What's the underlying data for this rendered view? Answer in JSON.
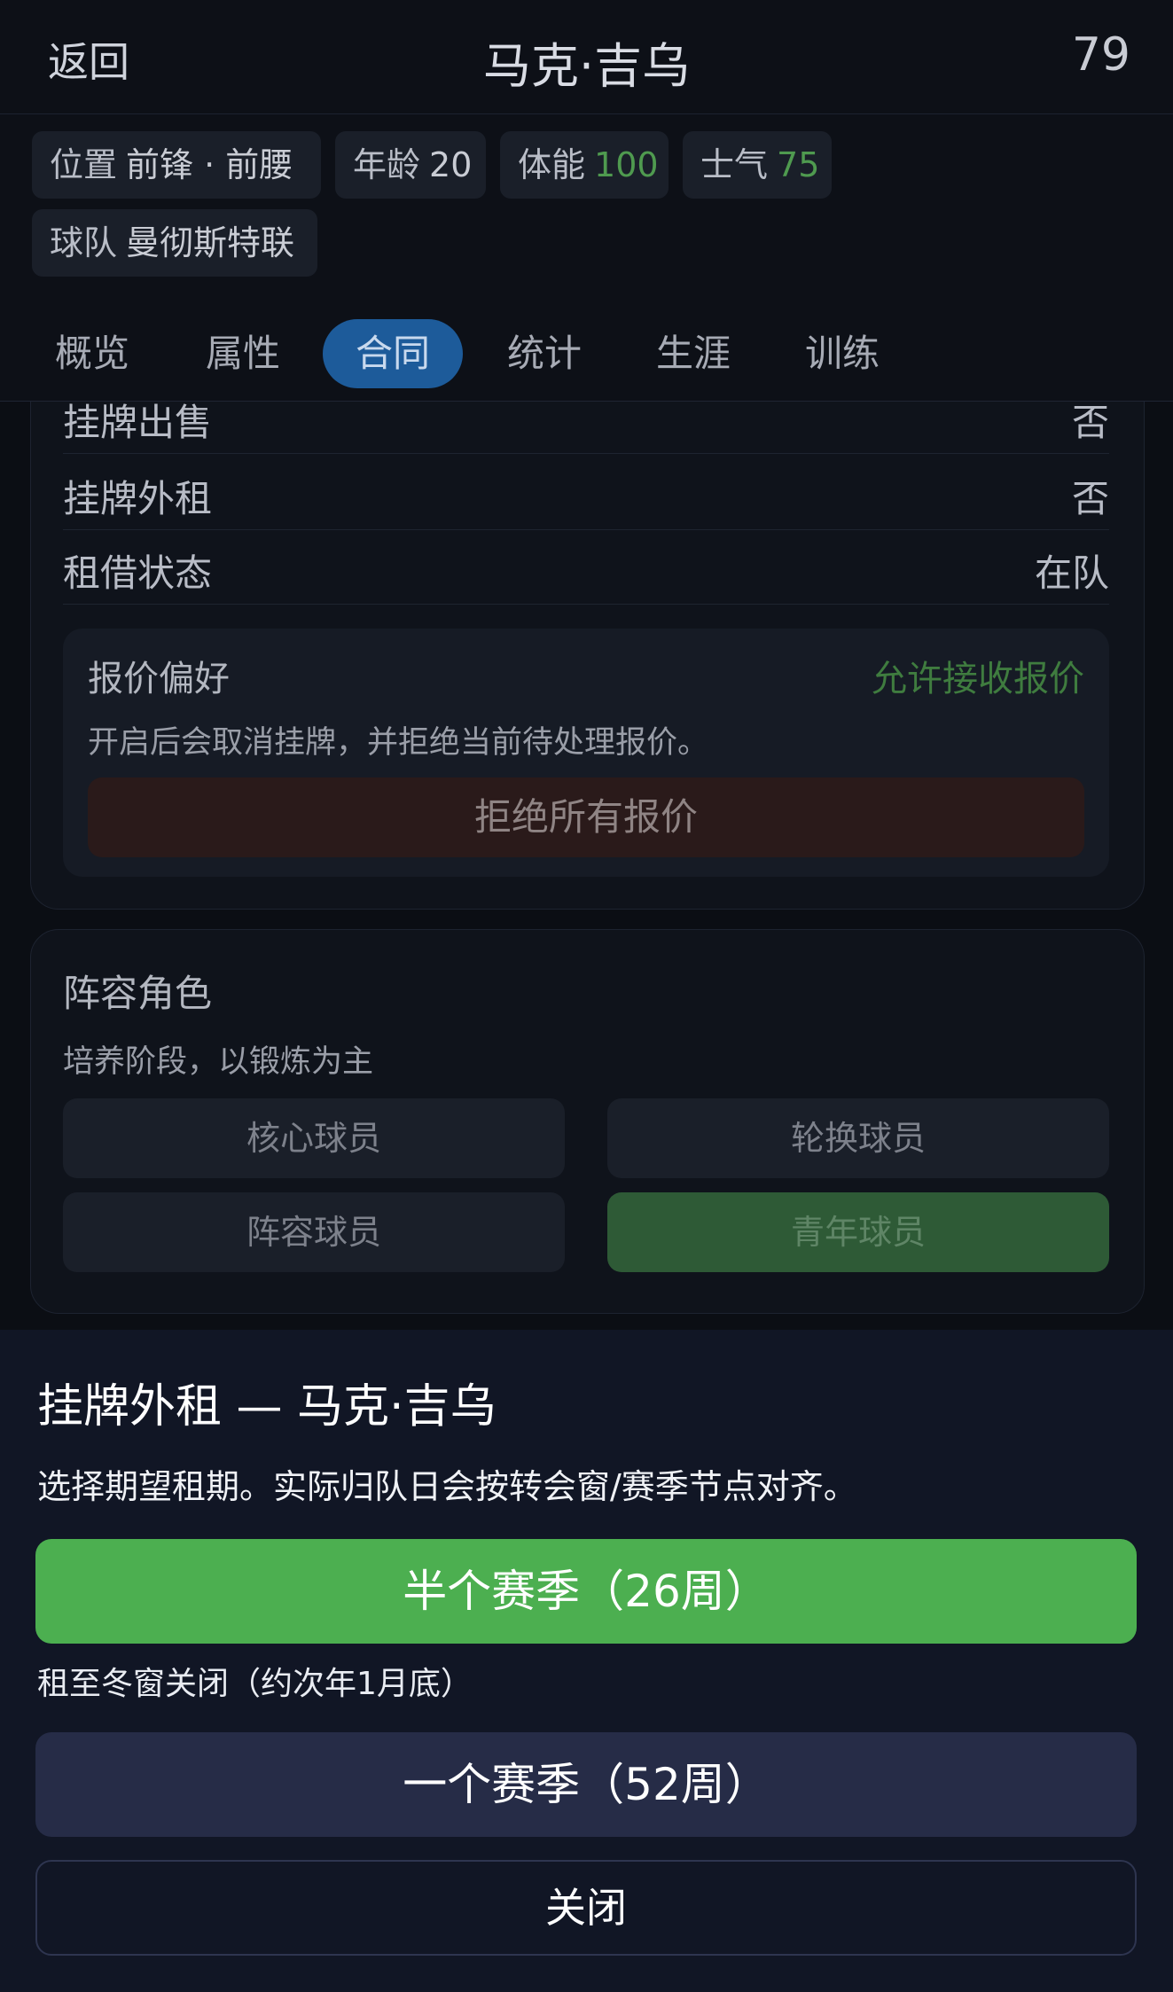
{
  "header": {
    "back_label": "返回",
    "title": "马克·吉乌",
    "overall": "79"
  },
  "info": {
    "position_label": "位置",
    "position_value": "前锋 · 前腰",
    "age_label": "年龄",
    "age_value": "20",
    "stamina_label": "体能",
    "stamina_value": "100",
    "morale_label": "士气",
    "morale_value": "75",
    "team_label": "球队",
    "team_value": "曼彻斯特联"
  },
  "tabs": [
    "概览",
    "属性",
    "合同",
    "统计",
    "生涯",
    "训练"
  ],
  "active_tab": "合同",
  "contract": {
    "rows": [
      {
        "label": "挂牌出售",
        "value": "否"
      },
      {
        "label": "挂牌外租",
        "value": "否"
      },
      {
        "label": "租借状态",
        "value": "在队"
      }
    ],
    "offer_pref": {
      "title": "报价偏好",
      "status": "允许接收报价",
      "desc": "开启后会取消挂牌，并拒绝当前待处理报价。",
      "reject_all_label": "拒绝所有报价"
    }
  },
  "squad_role": {
    "title": "阵容角色",
    "desc": "培养阶段，以锻炼为主",
    "options": [
      "核心球员",
      "轮换球员",
      "阵容球员",
      "青年球员"
    ],
    "selected": "青年球员"
  },
  "sheet": {
    "title": "挂牌外租 — 马克·吉乌",
    "desc": "选择期望租期。实际归队日会按转会窗/赛季节点对齐。",
    "half_season_label": "半个赛季（26周）",
    "half_season_note": "租至冬窗关闭（约次年1月底）",
    "full_season_label": "一个赛季（52周）",
    "close_label": "关闭"
  },
  "colors": {
    "accent_green": "#4caf50",
    "tab_active": "#1d5b9a",
    "sheet_bg": "#111625"
  }
}
